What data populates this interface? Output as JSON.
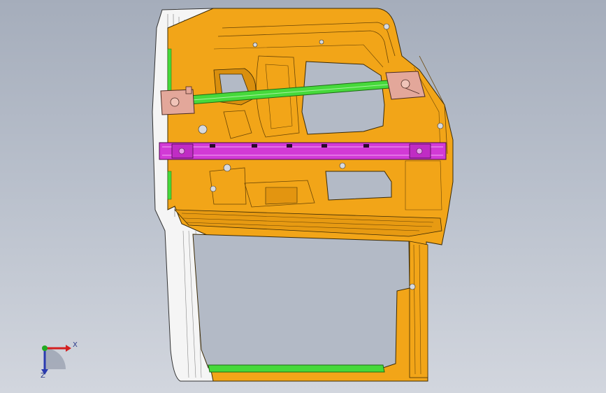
{
  "viewport": {
    "background_top": "#a5adbb",
    "background_bottom": "#d2d6de"
  },
  "model": {
    "part_colors": {
      "inner_panel": "#f2a518",
      "inner_panel_dark": "#c77d08",
      "outer_panel": "#f4f4f4",
      "guide_rail": "#46d93b",
      "reinforcement_beam": "#d23ad6",
      "hinge_brackets": "#e3a79a"
    }
  },
  "triad": {
    "x_label": "X",
    "z_label": "Z",
    "x_color": "#d42020",
    "y_color": "#22aa22",
    "z_color": "#2a3ab0"
  }
}
